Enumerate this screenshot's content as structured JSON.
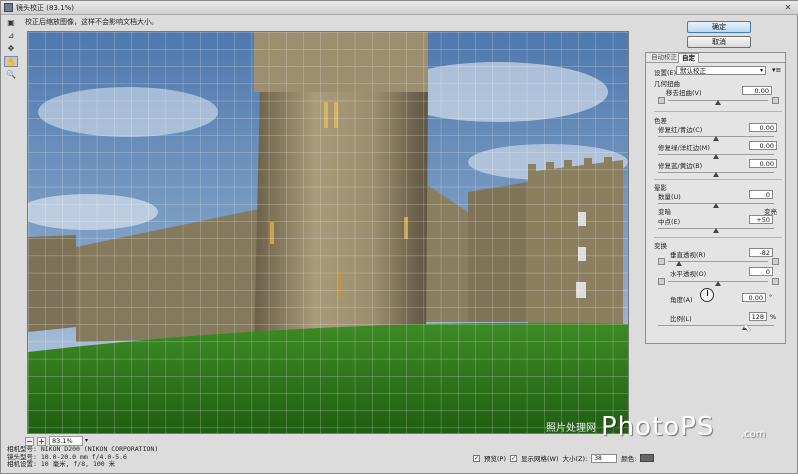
{
  "window": {
    "title": "镜头校正 (83.1%)",
    "close": "✕"
  },
  "hint": "校正后缩放图像，这样不会影响文档大小。",
  "tools": [
    "remove-distortion-tool",
    "straighten-tool",
    "move-grid-tool",
    "hand-tool",
    "zoom-tool"
  ],
  "buttons": {
    "ok": "确定",
    "cancel": "取消"
  },
  "tabs": {
    "auto": "自动校正",
    "custom": "自定"
  },
  "settings": {
    "label": "设置(E):",
    "value": "默认校正",
    "menu_icon": "▾≡"
  },
  "geometric": {
    "title": "几何扭曲",
    "remove_distortion_label": "移去扭曲(V)",
    "remove_distortion_value": "0.00"
  },
  "chromatic": {
    "title": "色差",
    "rows": [
      {
        "label": "修复红/青边(C)",
        "value": "0.00"
      },
      {
        "label": "修复绿/洋红边(M)",
        "value": "0.00"
      },
      {
        "label": "修复蓝/黄边(B)",
        "value": "0.00"
      }
    ]
  },
  "vignette": {
    "title": "晕影",
    "amount_label": "数量(U)",
    "amount_value": "0",
    "darken": "变暗",
    "lighten": "变亮",
    "midpoint_label": "中点(E)",
    "midpoint_value": "+50"
  },
  "transform": {
    "title": "变换",
    "vertical_label": "垂直透视(R)",
    "vertical_value": "-82",
    "horizontal_label": "水平透视(O)",
    "horizontal_value": "0",
    "angle_label": "角度(A)",
    "angle_value": "0.00",
    "angle_unit": "°",
    "scale_label": "比例(L)",
    "scale_value": "128",
    "scale_unit": "%"
  },
  "zoom": {
    "minus": "−",
    "plus": "+",
    "value": "83.1%"
  },
  "info": {
    "camera": "相机型号:  NIKON D200 (NIKON CORPORATION)",
    "lens": "镜头型号:  10.0-20.0 mm f/4.0-5.6",
    "settings": "相机设置:  10 毫米, f/8, 100 米"
  },
  "options": {
    "preview": "预览(P)",
    "show_grid": "显示网格(W)",
    "size_label": "大小(Z):",
    "size_value": "38",
    "color_label": "颜色:"
  },
  "watermark": {
    "cn": "照片处理网",
    "big": "PhotoPS",
    "dom": ".com"
  },
  "colors": {
    "accent": "#3c7fb1",
    "sky": "#5f86b5",
    "grass": "#2f7a1f",
    "stone": "#8f8266"
  }
}
